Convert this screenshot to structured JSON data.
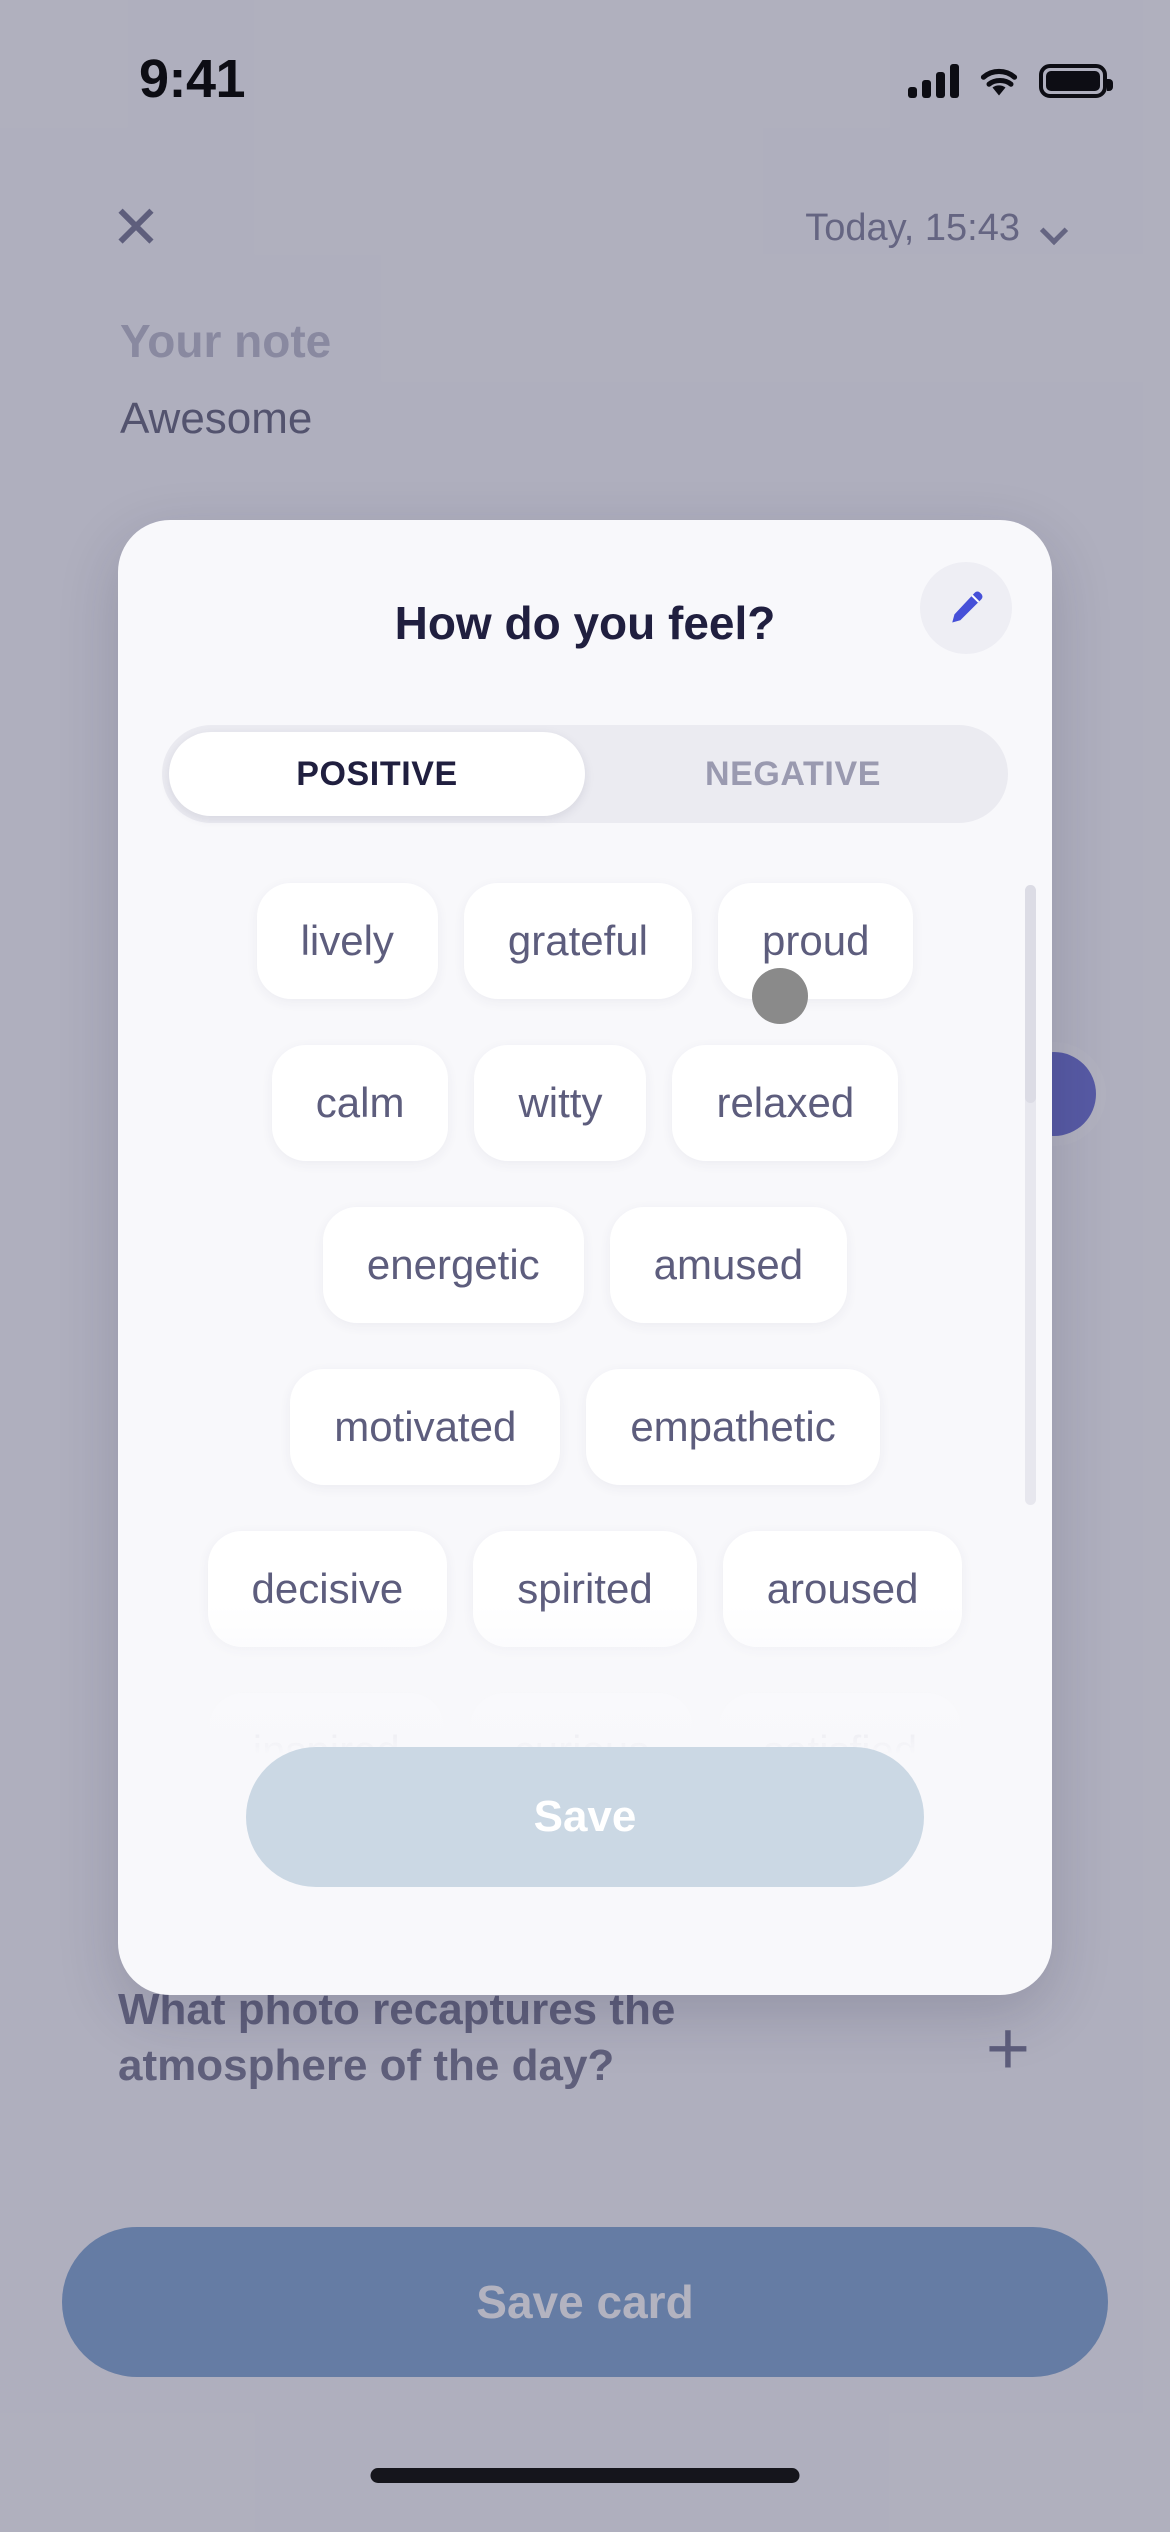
{
  "statusbar": {
    "time": "9:41",
    "icons": [
      "cellular-signal-icon",
      "wifi-icon",
      "battery-icon"
    ]
  },
  "topbar": {
    "close_label": "✕",
    "date_label": "Today, 15:43",
    "chevron_icon": "chevron-down-icon"
  },
  "note": {
    "label": "Your note",
    "value": "Awesome"
  },
  "photo_section": {
    "prompt": "What photo recaptures the atmosphere of the day?",
    "add_label": "+"
  },
  "footer": {
    "save_card_label": "Save card"
  },
  "modal": {
    "title": "How do you feel?",
    "edit_icon": "pencil-icon",
    "tabs": [
      {
        "label": "POSITIVE",
        "active": true
      },
      {
        "label": "NEGATIVE",
        "active": false
      }
    ],
    "emotion_rows": [
      [
        "lively",
        "grateful",
        "proud"
      ],
      [
        "calm",
        "witty",
        "relaxed"
      ],
      [
        "energetic",
        "amused"
      ],
      [
        "motivated",
        "empathetic"
      ],
      [
        "decisive",
        "spirited",
        "aroused"
      ],
      [
        "inspired",
        "curious",
        "satisfied"
      ]
    ],
    "save_label": "Save"
  },
  "colors": {
    "accent_blue": "#3f46c4",
    "save_card_blue": "#5d8cc4",
    "modal_bg": "#f8f8fb",
    "chip_text": "#5d5d7d",
    "title_text": "#201f3f",
    "overlay": "rgba(110,110,135,0.52)",
    "save_disabled": "#cbd8e4"
  }
}
